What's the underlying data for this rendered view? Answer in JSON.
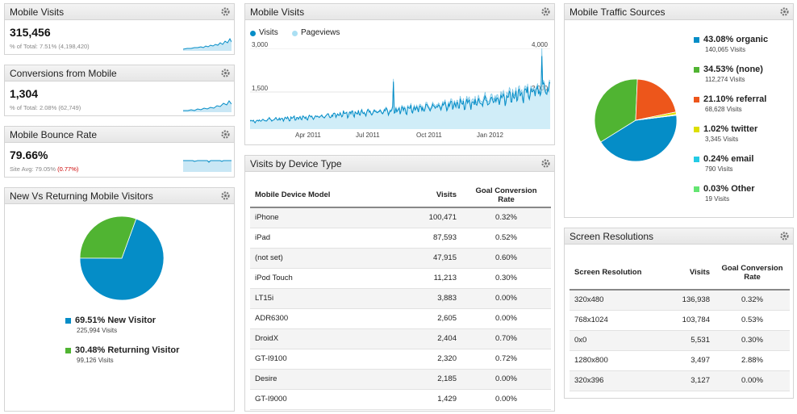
{
  "colors": {
    "accent": "#058dc7",
    "orange": "#ed561b",
    "green": "#50b432",
    "yellow": "#dddf00",
    "cyan": "#24cbe5",
    "lightgreen": "#64e572",
    "light_series": "#aadff3",
    "red_text": "#cc0000"
  },
  "mobile_visits_card": {
    "title": "Mobile Visits",
    "value": "315,456",
    "sub": "% of Total: 7.51% (4,198,420)"
  },
  "conversions_card": {
    "title": "Conversions from Mobile",
    "value": "1,304",
    "sub": "% of Total: 2.08% (62,749)"
  },
  "bounce_card": {
    "title": "Mobile Bounce Rate",
    "value": "79.66%",
    "sub_prefix": "Site Avg: 79.05%",
    "sub_delta": "(0.77%)"
  },
  "new_returning": {
    "title": "New Vs Returning Mobile Visitors",
    "items": [
      {
        "label": "69.51% New Visitor",
        "sub": "225,994 Visits",
        "value": 69.51,
        "color": "#058dc7"
      },
      {
        "label": "30.48% Returning Visitor",
        "sub": "99,126 Visits",
        "value": 30.48,
        "color": "#50b432"
      }
    ]
  },
  "visits_chart_widget": {
    "title": "Mobile Visits",
    "legend": [
      {
        "label": "Visits",
        "color": "#058dc7"
      },
      {
        "label": "Pageviews",
        "color": "#aadff3"
      }
    ],
    "left_ticks": [
      "3,000",
      "1,500"
    ],
    "right_ticks": [
      "4,000",
      "2,000"
    ],
    "x_ticks": [
      "Apr 2011",
      "Jul 2011",
      "Oct 2011",
      "Jan 2012"
    ]
  },
  "chart_data": {
    "type": "line",
    "x_ticks": [
      "Apr 2011",
      "Jul 2011",
      "Oct 2011",
      "Jan 2012"
    ],
    "series": [
      {
        "name": "Visits",
        "axis": "left",
        "values": [
          300,
          380,
          420,
          460,
          520,
          600,
          650,
          700,
          760,
          820,
          900,
          980,
          1050,
          1150,
          1300,
          1480,
          1650
        ]
      },
      {
        "name": "Pageviews",
        "axis": "right",
        "values": [
          400,
          500,
          560,
          620,
          700,
          820,
          900,
          980,
          1080,
          1180,
          1300,
          1420,
          1550,
          1700,
          1900,
          2100,
          2300
        ]
      }
    ],
    "left_axis": {
      "ticks": [
        "3,000",
        "1,500"
      ]
    },
    "right_axis": {
      "ticks": [
        "4,000",
        "2,000"
      ]
    },
    "grid": true,
    "legend_position": "top-left"
  },
  "device_table": {
    "title": "Visits by Device Type",
    "headers": [
      "Mobile Device Model",
      "Visits",
      "Goal Conversion Rate"
    ],
    "rows": [
      [
        "iPhone",
        "100,471",
        "0.32%"
      ],
      [
        "iPad",
        "87,593",
        "0.52%"
      ],
      [
        "(not set)",
        "47,915",
        "0.60%"
      ],
      [
        "iPod Touch",
        "11,213",
        "0.30%"
      ],
      [
        "LT15i",
        "3,883",
        "0.00%"
      ],
      [
        "ADR6300",
        "2,605",
        "0.00%"
      ],
      [
        "DroidX",
        "2,404",
        "0.70%"
      ],
      [
        "GT-I9100",
        "2,320",
        "0.72%"
      ],
      [
        "Desire",
        "2,185",
        "0.00%"
      ],
      [
        "GT-I9000",
        "1,429",
        "0.00%"
      ]
    ]
  },
  "traffic_sources": {
    "title": "Mobile Traffic Sources",
    "items": [
      {
        "label": "43.08% organic",
        "sub": "140,065 Visits",
        "value": 43.08,
        "color": "#058dc7"
      },
      {
        "label": "34.53% (none)",
        "sub": "112,274 Visits",
        "value": 34.53,
        "color": "#50b432"
      },
      {
        "label": "21.10% referral",
        "sub": "68,628 Visits",
        "value": 21.1,
        "color": "#ed561b"
      },
      {
        "label": "1.02% twitter",
        "sub": "3,345 Visits",
        "value": 1.02,
        "color": "#dddf00"
      },
      {
        "label": "0.24% email",
        "sub": "790 Visits",
        "value": 0.24,
        "color": "#24cbe5"
      },
      {
        "label": "0.03% Other",
        "sub": "19 Visits",
        "value": 0.03,
        "color": "#64e572"
      }
    ]
  },
  "resolutions_table": {
    "title": "Screen Resolutions",
    "headers": [
      "Screen Resolution",
      "Visits",
      "Goal Conversion Rate"
    ],
    "rows": [
      [
        "320x480",
        "136,938",
        "0.32%"
      ],
      [
        "768x1024",
        "103,784",
        "0.53%"
      ],
      [
        "0x0",
        "5,531",
        "0.30%"
      ],
      [
        "1280x800",
        "3,497",
        "2.88%"
      ],
      [
        "320x396",
        "3,127",
        "0.00%"
      ]
    ]
  }
}
